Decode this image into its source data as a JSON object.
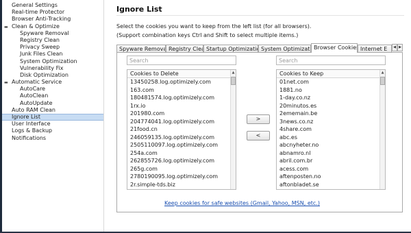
{
  "sidebar": {
    "items": [
      {
        "label": "General Settings",
        "level": 0
      },
      {
        "label": "Real-time Protector",
        "level": 0
      },
      {
        "label": "Browser Anti-Tracking",
        "level": 0
      },
      {
        "label": "Clean & Optimize",
        "level": 0,
        "expander": "minus-icon"
      },
      {
        "label": "Spyware Removal",
        "level": 1
      },
      {
        "label": "Registry Clean",
        "level": 1
      },
      {
        "label": "Privacy Sweep",
        "level": 1
      },
      {
        "label": "Junk Files Clean",
        "level": 1
      },
      {
        "label": "System Optimization",
        "level": 1
      },
      {
        "label": "Vulnerability Fix",
        "level": 1
      },
      {
        "label": "Disk Optimization",
        "level": 1
      },
      {
        "label": "Automatic Service",
        "level": 0,
        "expander": "minus-icon"
      },
      {
        "label": "AutoCare",
        "level": 1
      },
      {
        "label": "AutoClean",
        "level": 1
      },
      {
        "label": "AutoUpdate",
        "level": 1
      },
      {
        "label": "Auto RAM Clean",
        "level": 0
      },
      {
        "label": "Ignore List",
        "level": 0,
        "selected": true
      },
      {
        "label": "User Interface",
        "level": 0
      },
      {
        "label": "Logs & Backup",
        "level": 0
      },
      {
        "label": "Notifications",
        "level": 0
      }
    ]
  },
  "main": {
    "title": "Ignore List",
    "description_line1": "Select the cookies you want to keep from the left list (for all browsers).",
    "description_line2": "(Support combination keys Ctrl and Shift to select multiple items.)",
    "tabs": [
      {
        "label": "Spyware Removal"
      },
      {
        "label": "Registry Clean"
      },
      {
        "label": "Startup Optimization"
      },
      {
        "label": "System Optimization"
      },
      {
        "label": "Browser Cookies",
        "active": true
      },
      {
        "label": "Internet E"
      }
    ],
    "left": {
      "search_placeholder": "Search",
      "header": "Cookies to Delete",
      "items": [
        "13450258.log.optimizely.com",
        "163.com",
        "180481574.log.optimizely.com",
        "1rx.io",
        "201980.com",
        "204774041.log.optimizely.com",
        "21food.cn",
        "246059135.log.optimizely.com",
        "2505110097.log.optimizely.com",
        "254a.com",
        "262855726.log.optimizely.com",
        "265g.com",
        "2780190095.log.optimizely.com",
        "2r.simple-tds.biz"
      ]
    },
    "right": {
      "search_placeholder": "Search",
      "header": "Cookies to Keep",
      "items": [
        "01net.com",
        "1881.no",
        "1-day.co.nz",
        "20minutos.es",
        "2ememain.be",
        "3news.co.nz",
        "4share.com",
        "abc.es",
        "abcnyheter.no",
        "abnamro.nl",
        "abril.com.br",
        "acess.com",
        "aftenposten.no",
        "aftonbladet.se"
      ]
    },
    "buttons": {
      "move_right": ">",
      "move_left": "<"
    },
    "safe_link": "Keep cookies for safe websites (Gmail, Yahoo, MSN, etc.)"
  },
  "colors": {
    "selection": "#c7dcf3",
    "link": "#1a4fb0",
    "window_frame": "#1d2a3c"
  }
}
